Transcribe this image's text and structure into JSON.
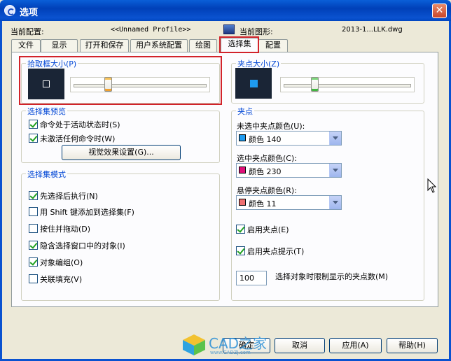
{
  "window": {
    "title": "选项",
    "close": "✕"
  },
  "header": {
    "profile_label": "当前配置:",
    "profile_value": "<<Unnamed Profile>>",
    "drawing_label": "当前图形:",
    "drawing_value": "2013-1...LLK.dwg"
  },
  "tabs": [
    {
      "label": "文件"
    },
    {
      "label": "显示"
    },
    {
      "label": "打开和保存"
    },
    {
      "label": "用户系统配置"
    },
    {
      "label": "绘图"
    },
    {
      "label": "选择集"
    },
    {
      "label": "配置"
    }
  ],
  "pickbox": {
    "title": "拾取框大小(P)",
    "level": 0.25
  },
  "gripsize": {
    "title": "夹点大小(Z)",
    "level": 0.23
  },
  "preview": {
    "title": "选择集预览",
    "items": [
      {
        "label": "命令处于活动状态时(S)",
        "checked": true
      },
      {
        "label": "未激活任何命令时(W)",
        "checked": true
      }
    ],
    "visual_button": "视觉效果设置(G)..."
  },
  "mode": {
    "title": "选择集模式",
    "items": [
      {
        "label": "先选择后执行(N)",
        "checked": true
      },
      {
        "label": "用 Shift 键添加到选择集(F)",
        "checked": false
      },
      {
        "label": "按住并拖动(D)",
        "checked": false
      },
      {
        "label": "隐含选择窗口中的对象(I)",
        "checked": true
      },
      {
        "label": "对象编组(O)",
        "checked": true
      },
      {
        "label": "关联填充(V)",
        "checked": false
      }
    ]
  },
  "grips": {
    "title": "夹点",
    "unselected_label": "未选中夹点颜色(U):",
    "unselected_value": "颜色 140",
    "unselected_color": "#1e9bf0",
    "selected_label": "选中夹点颜色(C):",
    "selected_value": "颜色 230",
    "selected_color": "#e0107a",
    "hover_label": "悬停夹点颜色(R):",
    "hover_value": "颜色 11",
    "hover_color": "#f07070",
    "enable": {
      "label": "启用夹点(E)",
      "checked": true
    },
    "tips": {
      "label": "启用夹点提示(T)",
      "checked": true
    },
    "limit_value": "100",
    "limit_label": "选择对象时限制显示的夹点数(M)"
  },
  "footer": {
    "ok": "确定",
    "cancel": "取消",
    "apply": "应用(A)",
    "help": "帮助(H)"
  },
  "watermark": {
    "text": "CAD之家",
    "url": "www.CADZJ.com"
  }
}
